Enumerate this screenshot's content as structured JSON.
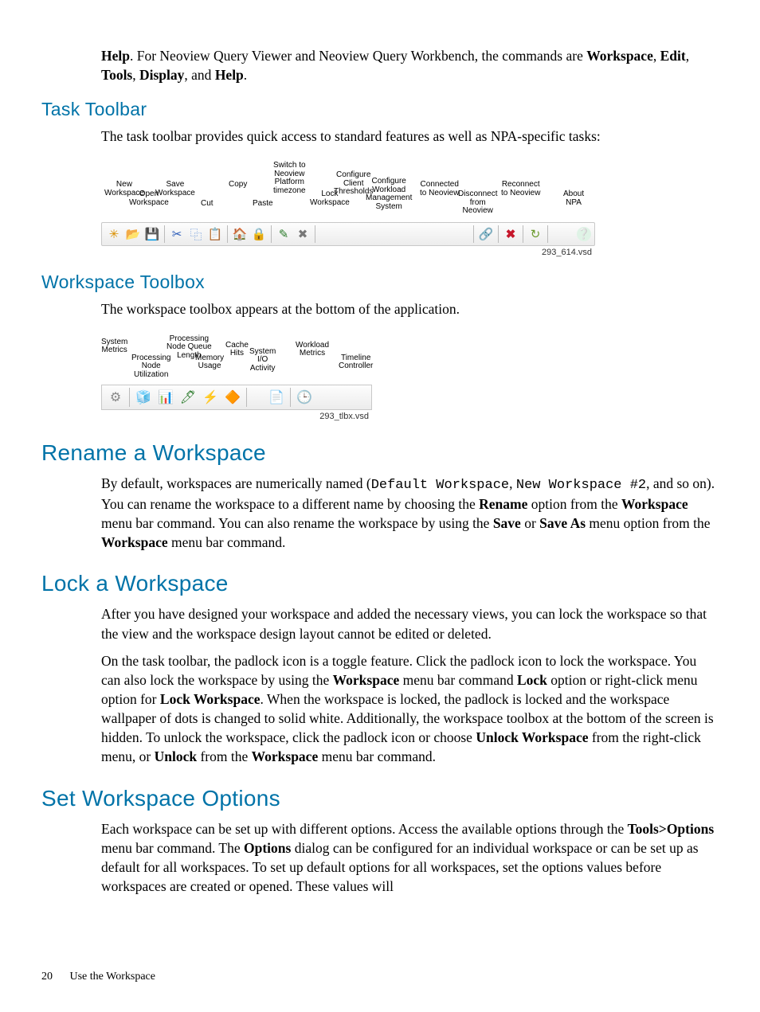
{
  "intro_paragraph": {
    "prefix_bold": "Help",
    "text1": ". For Neoview Query Viewer and Neoview Query Workbench, the commands are ",
    "w1": "Workspace",
    "c1": ", ",
    "w2": "Edit",
    "c2": ", ",
    "w3": "Tools",
    "c3": ", ",
    "w4": "Display",
    "c4": ", and ",
    "w5": "Help",
    "c5": "."
  },
  "s1": {
    "heading": "Task Toolbar",
    "para": "The task toolbar provides quick access to standard features as well as NPA-specific tasks:",
    "figure_caption": "293_614.vsd",
    "labels": [
      "New\nWorkspace",
      "Open\nWorkspace",
      "Save\nWorkspace",
      "Cut",
      "Copy",
      "Paste",
      "Switch to\nNeoview\nPlatform\ntimezone",
      "Lock\nWorkspace",
      "Configure\nClient\nThresholds",
      "Configure\nWorkload\nManagement\nSystem",
      "Connected\nto Neoview",
      "Disconnect\nfrom\nNeoview",
      "Reconnect\nto Neoview",
      "About\nNPA"
    ],
    "icons": [
      {
        "name": "new-workspace-icon",
        "glyph": "✳"
      },
      {
        "name": "open-workspace-icon",
        "glyph": "📂"
      },
      {
        "name": "save-workspace-icon",
        "glyph": "💾"
      },
      {
        "name": "sep"
      },
      {
        "name": "cut-icon",
        "glyph": "✂"
      },
      {
        "name": "copy-icon",
        "glyph": "⿻"
      },
      {
        "name": "paste-icon",
        "glyph": "📋"
      },
      {
        "name": "sep"
      },
      {
        "name": "timezone-icon",
        "glyph": "🏠"
      },
      {
        "name": "lock-workspace-icon",
        "glyph": "🔒"
      },
      {
        "name": "sep"
      },
      {
        "name": "configure-thresholds-icon",
        "glyph": "✎"
      },
      {
        "name": "configure-wms-icon",
        "glyph": "✖"
      },
      {
        "name": "sep"
      },
      {
        "name": "connected-icon",
        "glyph": "🔗"
      },
      {
        "name": "sep"
      },
      {
        "name": "disconnect-icon",
        "glyph": "✖"
      },
      {
        "name": "sep"
      },
      {
        "name": "reconnect-icon",
        "glyph": "↻"
      },
      {
        "name": "sep"
      },
      {
        "name": "about-icon",
        "glyph": "❔"
      }
    ]
  },
  "s2": {
    "heading": "Workspace Toolbox",
    "para": "The workspace toolbox appears at the bottom of the application.",
    "figure_caption": "293_tlbx.vsd",
    "labels": [
      "System\nMetrics",
      "Processing\nNode\nUtilization",
      "Processing\nNode Queue\nLength",
      "Memory\nUsage",
      "Cache\nHits",
      "System\nI/O\nActivity",
      "Workload\nMetrics",
      "Timeline\nController"
    ],
    "icons": [
      {
        "name": "system-metrics-icon",
        "glyph": "⚙"
      },
      {
        "name": "sep"
      },
      {
        "name": "proc-node-util-icon",
        "glyph": "🧊"
      },
      {
        "name": "proc-queue-icon",
        "glyph": "📊"
      },
      {
        "name": "memory-usage-icon",
        "glyph": "🖊"
      },
      {
        "name": "cache-hits-icon",
        "glyph": "⚡"
      },
      {
        "name": "system-io-icon",
        "glyph": "🔶"
      },
      {
        "name": "sep"
      },
      {
        "name": "workload-metrics-icon",
        "glyph": "📄"
      },
      {
        "name": "sep"
      },
      {
        "name": "timeline-controller-icon",
        "glyph": "🕒"
      }
    ]
  },
  "s3": {
    "heading": "Rename a Workspace",
    "p": {
      "t1": "By default, workspaces are numerically named (",
      "code1": "Default Workspace",
      "t2": ", ",
      "code2": "New Workspace #2",
      "t3": ", and so on). You can rename the workspace to a different name by choosing the ",
      "b1": "Rename",
      "t4": " option from the ",
      "b2": "Workspace",
      "t5": " menu bar command. You can also rename the workspace by using the ",
      "b3": "Save",
      "t6": " or ",
      "b4": "Save As",
      "t7": " menu option from the ",
      "b5": "Workspace",
      "t8": " menu bar command."
    }
  },
  "s4": {
    "heading": "Lock a Workspace",
    "p1": "After you have designed your workspace and added the necessary views, you can lock the workspace so that the view and the workspace design layout cannot be edited or deleted.",
    "p2": {
      "t1": "On the task toolbar, the padlock icon is a toggle feature. Click the padlock icon to lock the workspace. You can also lock the workspace by using the ",
      "b1": "Workspace",
      "t2": " menu bar command ",
      "b2": "Lock",
      "t3": " option or right-click menu option for ",
      "b3": "Lock Workspace",
      "t4": ". When the workspace is locked, the padlock is locked and the workspace wallpaper of dots is changed to solid white. Additionally, the workspace toolbox at the bottom of the screen is hidden. To unlock the workspace, click the padlock icon or choose ",
      "b4": "Unlock Workspace",
      "t5": " from the right-click menu, or ",
      "b5": "Unlock",
      "t6": " from the ",
      "b6": "Workspace",
      "t7": " menu bar command."
    }
  },
  "s5": {
    "heading": "Set Workspace Options",
    "p": {
      "t1": "Each workspace can be set up with different options. Access the available options through the ",
      "b1": "Tools>Options",
      "t2": " menu bar command. The ",
      "b2": "Options",
      "t3": " dialog can be configured for an individual workspace or can be set up as default for all workspaces. To set up default options for all workspaces, set the options values before workspaces are created or opened. These values will"
    }
  },
  "footer": {
    "page_number": "20",
    "section": "Use the Workspace"
  }
}
